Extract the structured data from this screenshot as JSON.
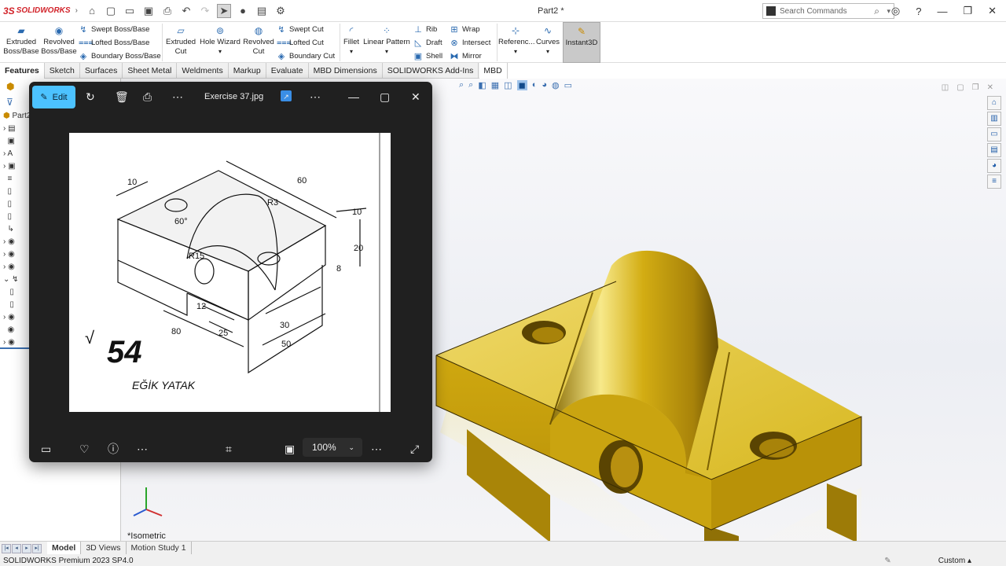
{
  "app": {
    "brand": "SOLIDWORKS",
    "doc_title": "Part2 *"
  },
  "search": {
    "placeholder": "Search Commands"
  },
  "ribbon": {
    "extruded_boss": "Extruded Boss/Base",
    "revolved_boss": "Revolved Boss/Base",
    "swept_boss": "Swept Boss/Base",
    "lofted_boss": "Lofted Boss/Base",
    "boundary_boss": "Boundary Boss/Base",
    "extruded_cut": "Extruded Cut",
    "hole_wizard": "Hole Wizard",
    "revolved_cut": "Revolved Cut",
    "swept_cut": "Swept Cut",
    "lofted_cut": "Lofted Cut",
    "boundary_cut": "Boundary Cut",
    "fillet": "Fillet",
    "linear_pattern": "Linear Pattern",
    "rib": "Rib",
    "draft": "Draft",
    "shell": "Shell",
    "wrap": "Wrap",
    "intersect": "Intersect",
    "mirror": "Mirror",
    "reference": "Referenc...",
    "curves": "Curves",
    "instant3d": "Instant3D"
  },
  "tabs": [
    "Features",
    "Sketch",
    "Surfaces",
    "Sheet Metal",
    "Weldments",
    "Markup",
    "Evaluate",
    "MBD Dimensions",
    "SOLIDWORKS Add-Ins",
    "MBD"
  ],
  "tree": {
    "part_label": "Part2"
  },
  "viewer": {
    "edit_label": "Edit",
    "file_name": "Exercise 37.jpg",
    "zoom": "100%",
    "drawing": {
      "dims": [
        "10",
        "60",
        "R3",
        "60°",
        "10",
        "20",
        "8",
        "R15",
        "12",
        "80",
        "25",
        "30",
        "50"
      ],
      "handwritten_number": "54",
      "caption": "EĞİK  YATAK"
    }
  },
  "viewport": {
    "view_name": "*Isometric"
  },
  "bottom_tabs": [
    "Model",
    "3D Views",
    "Motion Study 1"
  ],
  "status": {
    "version": "SOLIDWORKS Premium 2023 SP4.0",
    "units": "Custom"
  },
  "colors": {
    "edit_accent": "#4cc2ff",
    "gold": "#d4b11a",
    "viewer_bg": "#202020"
  }
}
